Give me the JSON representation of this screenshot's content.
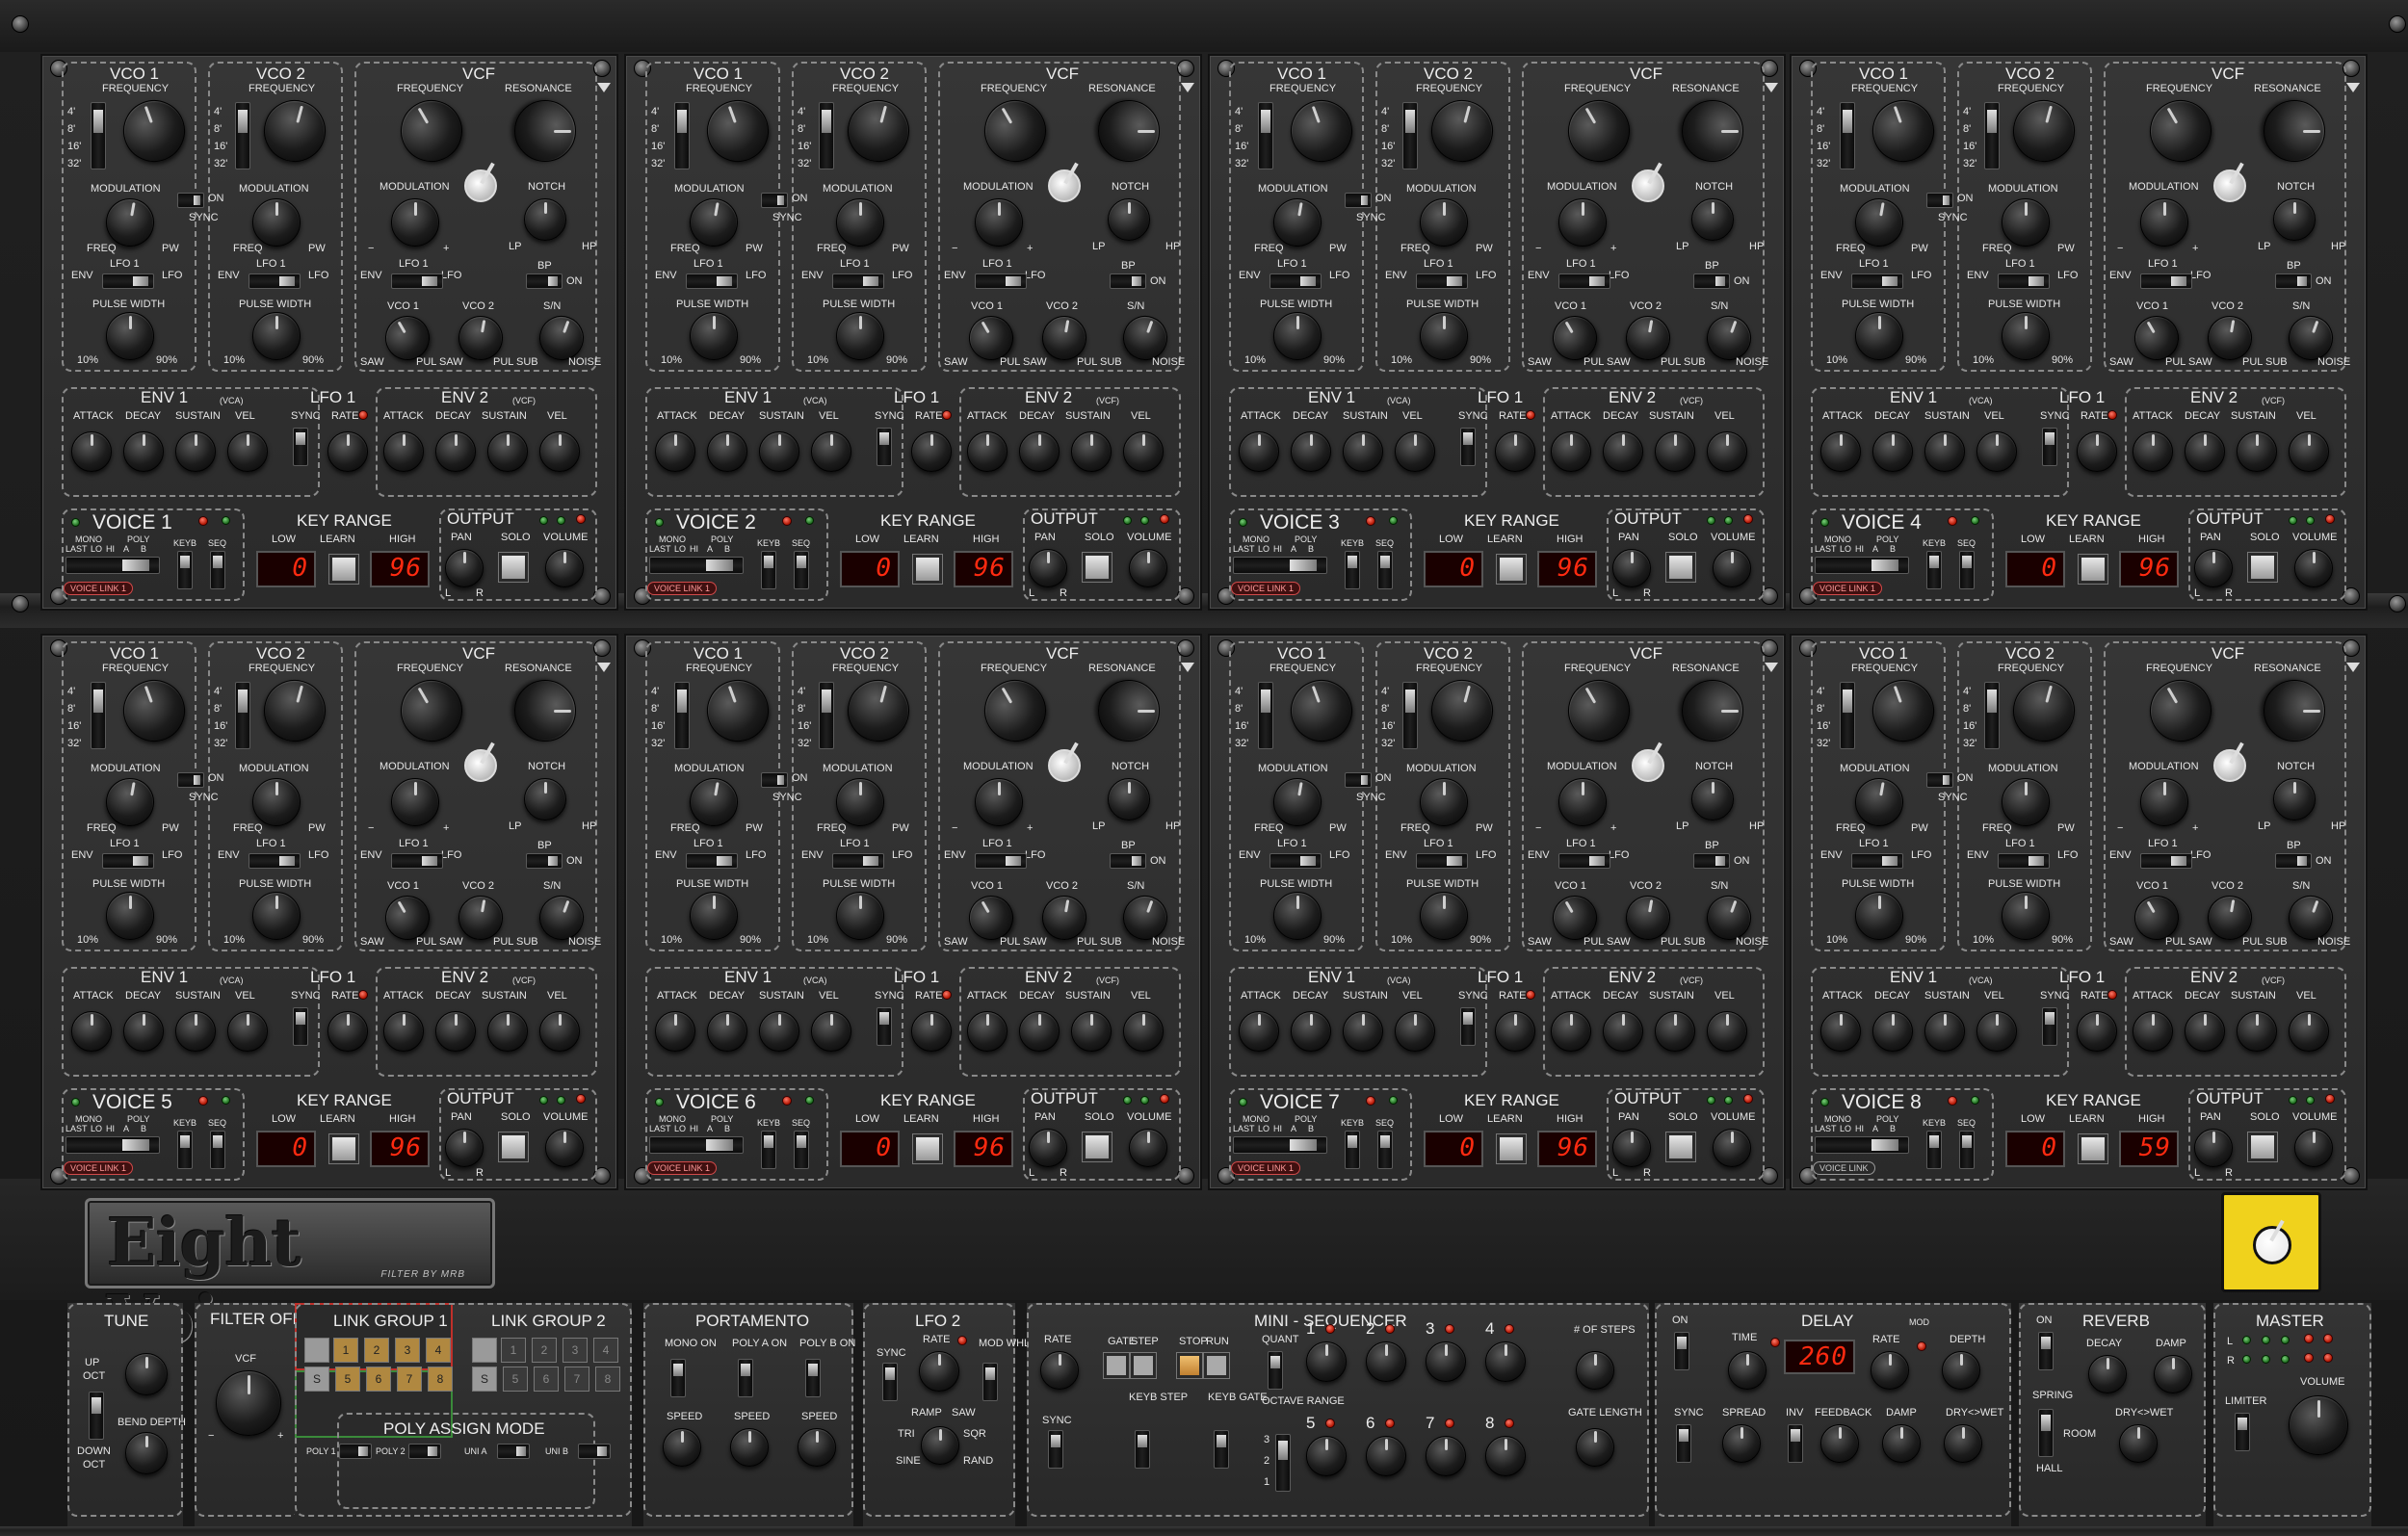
{
  "app": {
    "title": "Eight Voice",
    "subtitle": "FILTER BY MRB"
  },
  "voice_labels": {
    "vco1": "VCO 1",
    "vco2": "VCO 2",
    "frequency": "FREQUENCY",
    "octaves": [
      "4'",
      "8'",
      "16'",
      "32'"
    ],
    "modulation": "MODULATION",
    "freq": "FREQ",
    "pw": "PW",
    "sync": "SYNC",
    "on": "ON",
    "lfo1": "LFO 1",
    "env": "ENV",
    "lfo": "LFO",
    "one": "1",
    "two": "2",
    "pulse_width": "PULSE WIDTH",
    "pct10": "10%",
    "pct90": "90%",
    "vcf": "VCF",
    "resonance": "RESONANCE",
    "notch": "NOTCH",
    "minus": "−",
    "plus": "+",
    "lp": "LP",
    "hp": "HP",
    "bp": "BP",
    "vco1_short": "VCO 1",
    "vco2_short": "VCO 2",
    "sn": "S/N",
    "saw": "SAW",
    "pul": "PUL",
    "sub": "SUB",
    "noise": "NOISE",
    "env1": "ENV 1",
    "vca": "(VCA)",
    "env2": "ENV 2",
    "vcf_tag": "(VCF)",
    "attack": "ATTACK",
    "decay": "DECAY",
    "sustain": "SUSTAIN",
    "vel": "VEL",
    "rate": "RATE",
    "key_range": "KEY RANGE",
    "low": "LOW",
    "learn": "LEARN",
    "high": "HIGH",
    "output": "OUTPUT",
    "pan": "PAN",
    "solo": "SOLO",
    "volume": "VOLUME",
    "l": "L",
    "r": "R",
    "mono": "MONO",
    "poly": "POLY",
    "last": "LAST",
    "lo": "LO",
    "hi": "HI",
    "a": "A",
    "b": "B",
    "keyb": "KEYB",
    "seq": "SEQ"
  },
  "voices": [
    {
      "name": "VOICE 1",
      "low": "0",
      "high": "96",
      "link": "VOICE LINK 1",
      "linked": true
    },
    {
      "name": "VOICE 2",
      "low": "0",
      "high": "96",
      "link": "VOICE LINK 1",
      "linked": true
    },
    {
      "name": "VOICE 3",
      "low": "0",
      "high": "96",
      "link": "VOICE LINK 1",
      "linked": true
    },
    {
      "name": "VOICE 4",
      "low": "0",
      "high": "96",
      "link": "VOICE LINK 1",
      "linked": true
    },
    {
      "name": "VOICE 5",
      "low": "0",
      "high": "96",
      "link": "VOICE LINK 1",
      "linked": true
    },
    {
      "name": "VOICE 6",
      "low": "0",
      "high": "96",
      "link": "VOICE LINK 1",
      "linked": true
    },
    {
      "name": "VOICE 7",
      "low": "0",
      "high": "96",
      "link": "VOICE LINK 1",
      "linked": true
    },
    {
      "name": "VOICE 8",
      "low": "0",
      "high": "59",
      "link": "VOICE LINK",
      "linked": false
    }
  ],
  "tune": {
    "title": "TUNE",
    "up": "UP",
    "oct": "OCT",
    "down": "DOWN",
    "bend_depth": "BEND DEPTH"
  },
  "filter_offset": {
    "title": "FILTER OFFSET",
    "vcf": "VCF",
    "minus": "−",
    "plus": "+"
  },
  "link_groups": {
    "g1": "LINK GROUP 1",
    "g2": "LINK GROUP 2",
    "top": [
      "1",
      "2",
      "3",
      "4"
    ],
    "bottom": [
      "S",
      "5",
      "6",
      "7",
      "8"
    ],
    "g2_top": [
      "1",
      "2",
      "3",
      "4"
    ],
    "g2_bottom": [
      "S",
      "5",
      "6",
      "7",
      "8"
    ],
    "poly_assign": "POLY ASSIGN MODE",
    "modes": [
      "POLY 1",
      "POLY 2",
      "UNI A",
      "UNI B"
    ]
  },
  "portamento": {
    "title": "PORTAMENTO",
    "mono_on": "MONO ON",
    "poly_a_on": "POLY A ON",
    "poly_b_on": "POLY B ON",
    "speed": "SPEED"
  },
  "lfo2": {
    "title": "LFO 2",
    "sync": "SYNC",
    "rate": "RATE",
    "mod_whl": "MOD WHL",
    "ramp": "RAMP",
    "saw": "SAW",
    "tri": "TRI",
    "sqr": "SQR",
    "sine": "SINE",
    "rand": "RAND"
  },
  "sequencer": {
    "title": "MINI - SEQUENCER",
    "rate": "RATE",
    "gate": "GATE",
    "step": "STEP",
    "stop": "STOP",
    "run": "RUN",
    "quant": "QUANT",
    "sync": "SYNC",
    "keyb_step": "KEYB STEP",
    "keyb_gate": "KEYB GATE",
    "octave_range": "OCTAVE RANGE",
    "octaves": [
      "3",
      "2",
      "1"
    ],
    "steps_label": "# OF STEPS",
    "gate_length": "GATE LENGTH",
    "steps": [
      "1",
      "2",
      "3",
      "4",
      "5",
      "6",
      "7",
      "8"
    ]
  },
  "delay": {
    "title": "DELAY",
    "on": "ON",
    "time": "TIME",
    "time_value": "260",
    "rate": "RATE",
    "mod": "MOD",
    "depth": "DEPTH",
    "sync": "SYNC",
    "spread": "SPREAD",
    "inv": "INV",
    "feedback": "FEEDBACK",
    "damp": "DAMP",
    "drywet": "DRY<>WET"
  },
  "reverb": {
    "title": "REVERB",
    "on": "ON",
    "decay": "DECAY",
    "damp": "DAMP",
    "spring": "SPRING",
    "room": "ROOM",
    "hall": "HALL",
    "drywet": "DRY<>WET"
  },
  "master": {
    "title": "MASTER",
    "l": "L",
    "r": "R",
    "limiter": "LIMITER",
    "volume": "VOLUME"
  },
  "colors": {
    "led_red": "#d01800",
    "led_green": "#2a8a2a",
    "display_red": "#ff2a10",
    "badge_yellow": "#f0d21c"
  }
}
